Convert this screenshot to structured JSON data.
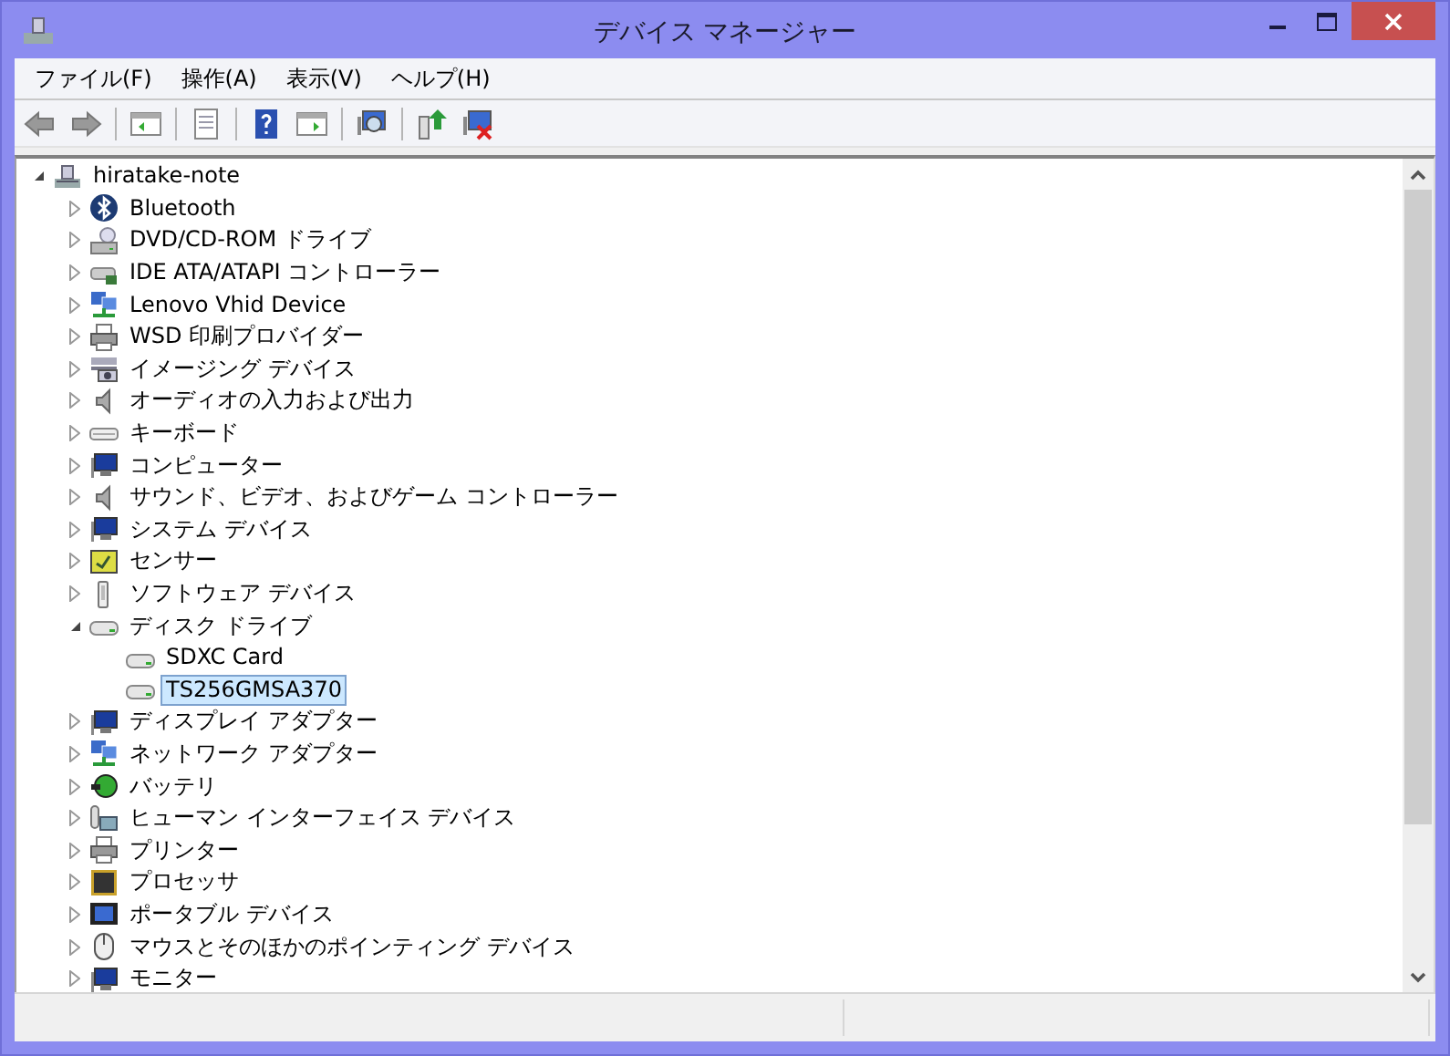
{
  "window": {
    "title": "デバイス マネージャー"
  },
  "menu": [
    "ファイル(F)",
    "操作(A)",
    "表示(V)",
    "ヘルプ(H)"
  ],
  "toolbar": [
    {
      "kind": "back",
      "disabled": false
    },
    {
      "kind": "forward",
      "disabled": false
    },
    {
      "kind": "separator"
    },
    {
      "kind": "tree",
      "disabled": false
    },
    {
      "kind": "separator"
    },
    {
      "kind": "properties",
      "disabled": false
    },
    {
      "kind": "separator"
    },
    {
      "kind": "help",
      "disabled": false
    },
    {
      "kind": "pane",
      "disabled": false
    },
    {
      "kind": "separator"
    },
    {
      "kind": "scan",
      "disabled": false
    },
    {
      "kind": "separator"
    },
    {
      "kind": "update",
      "disabled": false
    },
    {
      "kind": "disable",
      "disabled": false
    }
  ],
  "tree": {
    "label": "hiratake-note",
    "kind": "computer",
    "expanded": true,
    "selected": false,
    "children": [
      {
        "label": "Bluetooth",
        "kind": "bluetooth",
        "expanded": false,
        "selected": false
      },
      {
        "label": "DVD/CD-ROM ドライブ",
        "kind": "dvd",
        "expanded": false,
        "selected": false
      },
      {
        "label": "IDE ATA/ATAPI コントローラー",
        "kind": "ide",
        "expanded": false,
        "selected": false
      },
      {
        "label": "Lenovo Vhid Device",
        "kind": "network",
        "expanded": false,
        "selected": false
      },
      {
        "label": "WSD 印刷プロバイダー",
        "kind": "printer",
        "expanded": false,
        "selected": false
      },
      {
        "label": "イメージング デバイス",
        "kind": "camera",
        "expanded": false,
        "selected": false
      },
      {
        "label": "オーディオの入力および出力",
        "kind": "speaker",
        "expanded": false,
        "selected": false
      },
      {
        "label": "キーボード",
        "kind": "keyboard",
        "expanded": false,
        "selected": false
      },
      {
        "label": "コンピューター",
        "kind": "monitor",
        "expanded": false,
        "selected": false
      },
      {
        "label": "サウンド、ビデオ、およびゲーム コントローラー",
        "kind": "speaker",
        "expanded": false,
        "selected": false
      },
      {
        "label": "システム デバイス",
        "kind": "monitor",
        "expanded": false,
        "selected": false
      },
      {
        "label": "センサー",
        "kind": "sensor",
        "expanded": false,
        "selected": false
      },
      {
        "label": "ソフトウェア デバイス",
        "kind": "software",
        "expanded": false,
        "selected": false
      },
      {
        "label": "ディスク ドライブ",
        "kind": "disk",
        "expanded": true,
        "selected": false,
        "children": [
          {
            "label": "SDXC Card",
            "kind": "disk",
            "selected": false
          },
          {
            "label": "TS256GMSA370",
            "kind": "disk",
            "selected": true
          }
        ]
      },
      {
        "label": "ディスプレイ アダプター",
        "kind": "monitor",
        "expanded": false,
        "selected": false
      },
      {
        "label": "ネットワーク アダプター",
        "kind": "network",
        "expanded": false,
        "selected": false
      },
      {
        "label": "バッテリ",
        "kind": "battery",
        "expanded": false,
        "selected": false
      },
      {
        "label": "ヒューマン インターフェイス デバイス",
        "kind": "hid",
        "expanded": false,
        "selected": false
      },
      {
        "label": "プリンター",
        "kind": "printer",
        "expanded": false,
        "selected": false
      },
      {
        "label": "プロセッサ",
        "kind": "processor",
        "expanded": false,
        "selected": false
      },
      {
        "label": "ポータブル デバイス",
        "kind": "portable",
        "expanded": false,
        "selected": false
      },
      {
        "label": "マウスとそのほかのポインティング デバイス",
        "kind": "mouse",
        "expanded": false,
        "selected": false
      },
      {
        "label": "モニター",
        "kind": "monitor",
        "expanded": false,
        "selected": false
      }
    ]
  }
}
